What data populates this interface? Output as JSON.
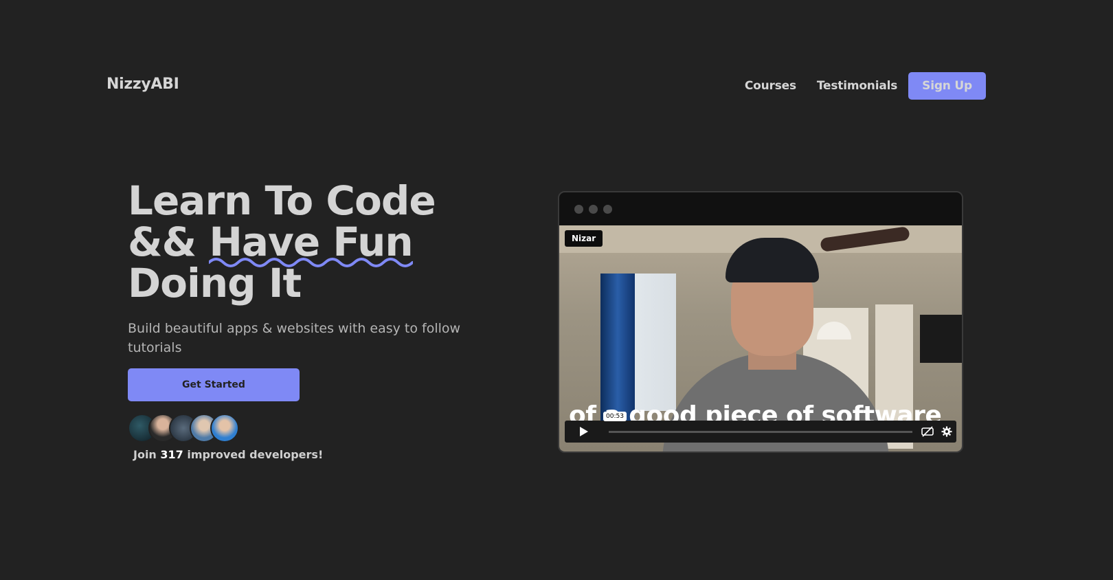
{
  "nav": {
    "brand": "NizzyABI",
    "links": [
      "Courses",
      "Testimonials"
    ],
    "signup_label": "Sign Up"
  },
  "hero": {
    "headline_line1": "Learn To Code",
    "headline_line2_prefix": "&& ",
    "headline_line2_highlight": "Have Fun",
    "headline_line3": "Doing It",
    "subtitle": "Build beautiful apps & websites with easy to follow tutorials",
    "cta_label": "Get Started",
    "join_prefix": "Join ",
    "join_count": "317",
    "join_suffix": " improved developers!"
  },
  "video": {
    "name_tag": "Nizar",
    "caption": "of a good piece of software",
    "time": "00:53"
  },
  "colors": {
    "background": "#222222",
    "accent": "#7f89f5"
  },
  "icons": {
    "play": "play-icon",
    "captions_off": "captions-off-icon",
    "settings": "gear-icon"
  }
}
